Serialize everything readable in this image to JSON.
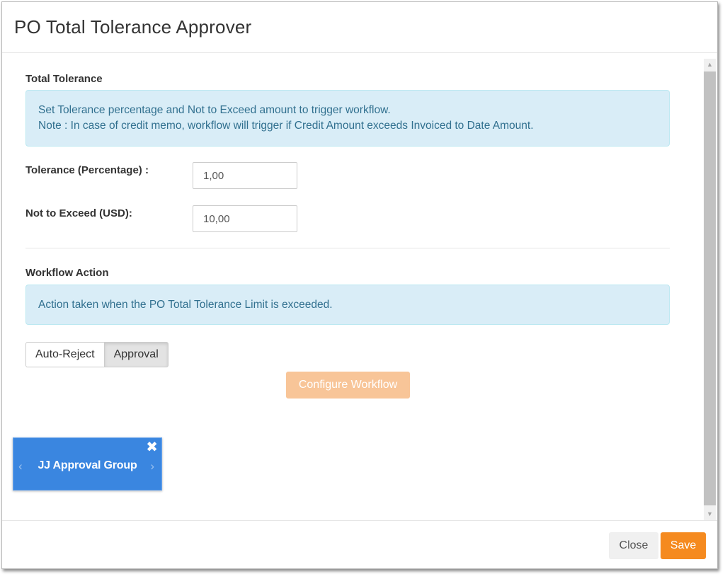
{
  "modal": {
    "title": "PO Total Tolerance Approver"
  },
  "total_tolerance": {
    "section_title": "Total Tolerance",
    "info_line1": "Set Tolerance percentage and Not to Exceed amount to trigger workflow.",
    "info_line2": "Note : In case of credit memo, workflow will trigger if Credit Amount exceeds Invoiced to Date Amount.",
    "tolerance_label": "Tolerance (Percentage) :",
    "tolerance_value": "1,00",
    "not_to_exceed_label": "Not to Exceed (USD):",
    "not_to_exceed_value": "10,00"
  },
  "workflow_action": {
    "section_title": "Workflow Action",
    "info": "Action taken when the PO Total Tolerance Limit is exceeded.",
    "options": [
      "Auto-Reject",
      "Approval"
    ],
    "selected": "Approval",
    "configure_label": "Configure Workflow"
  },
  "approval_group": {
    "label": "JJ Approval Group",
    "close_icon": "✖",
    "prev_icon": "‹",
    "next_icon": "›"
  },
  "footer": {
    "close_label": "Close",
    "save_label": "Save"
  },
  "colors": {
    "accent": "#f58a1f",
    "accent_disabled": "#f8c598",
    "info_bg": "#d9edf7",
    "info_text": "#31708f",
    "group_card": "#3a86e0"
  }
}
